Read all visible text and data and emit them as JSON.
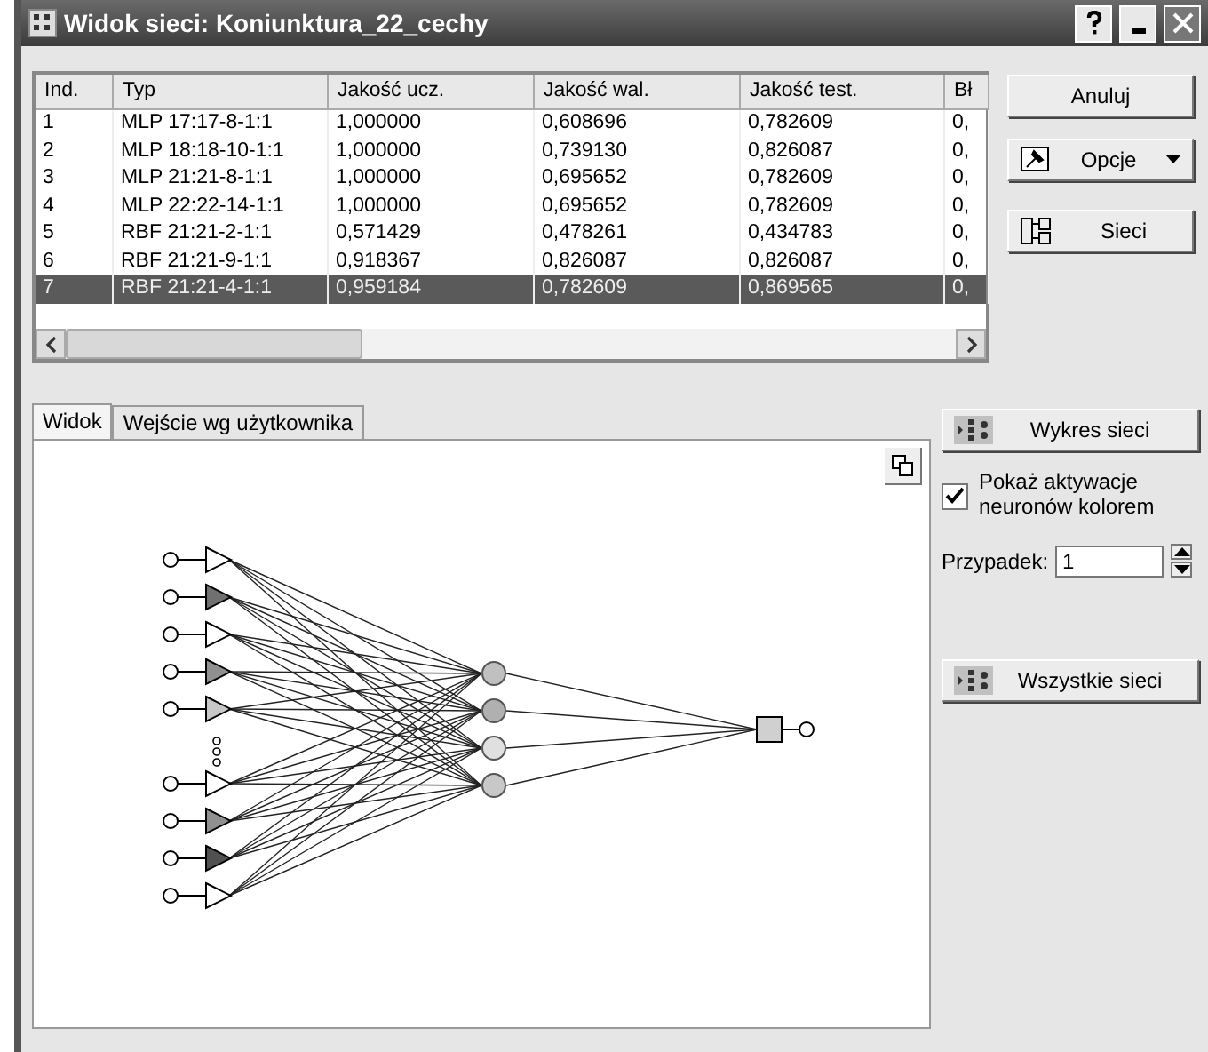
{
  "window": {
    "title": "Widok sieci: Koniunktura_22_cechy"
  },
  "table": {
    "columns": [
      "Ind.",
      "Typ",
      "Jakość ucz.",
      "Jakość wal.",
      "Jakość test.",
      "Bł"
    ],
    "rows": [
      {
        "cells": [
          "1",
          "MLP 17:17-8-1:1",
          "1,000000",
          "0,608696",
          "0,782609",
          "0,"
        ],
        "selected": false
      },
      {
        "cells": [
          "2",
          "MLP 18:18-10-1:1",
          "1,000000",
          "0,739130",
          "0,826087",
          "0,"
        ],
        "selected": false
      },
      {
        "cells": [
          "3",
          "MLP 21:21-8-1:1",
          "1,000000",
          "0,695652",
          "0,782609",
          "0,"
        ],
        "selected": false
      },
      {
        "cells": [
          "4",
          "MLP 22:22-14-1:1",
          "1,000000",
          "0,695652",
          "0,782609",
          "0,"
        ],
        "selected": false
      },
      {
        "cells": [
          "5",
          "RBF 21:21-2-1:1",
          "0,571429",
          "0,478261",
          "0,434783",
          "0,"
        ],
        "selected": false
      },
      {
        "cells": [
          "6",
          "RBF 21:21-9-1:1",
          "0,918367",
          "0,826087",
          "0,826087",
          "0,"
        ],
        "selected": false
      },
      {
        "cells": [
          "7",
          "RBF 21:21-4-1:1",
          "0,959184",
          "0,782609",
          "0,869565",
          "0,"
        ],
        "selected": true
      }
    ]
  },
  "side_buttons": [
    {
      "label": "Anuluj",
      "kind": "plain"
    },
    {
      "label": "Opcje",
      "kind": "menu"
    },
    {
      "label": "Sieci",
      "kind": "networks"
    }
  ],
  "tabs": [
    {
      "label": "Widok",
      "selected": true
    },
    {
      "label": "Wejście wg użytkownika",
      "selected": false
    }
  ],
  "network": {
    "inputs": [
      {
        "color": "#ffffff"
      },
      {
        "color": "#707070"
      },
      {
        "color": "#ffffff"
      },
      {
        "color": "#909090"
      },
      {
        "color": "#c8c8c8"
      },
      {
        "color": "#ffffff"
      },
      {
        "color": "#909090"
      },
      {
        "color": "#505050"
      },
      {
        "color": "#ffffff"
      }
    ],
    "hidden": [
      {
        "color": "#c0c0c0"
      },
      {
        "color": "#b0b0b0"
      },
      {
        "color": "#e0e0e0"
      },
      {
        "color": "#c8c8c8"
      }
    ],
    "output": {
      "color": "#d0d0d0"
    }
  },
  "chart_button": {
    "label": "Wykres sieci"
  },
  "show_activation": {
    "label": "Pokaż aktywacje neuronów kolorem",
    "checked": true
  },
  "case": {
    "label": "Przypadek:",
    "value": "1"
  },
  "all_networks_button": {
    "label": "Wszystkie sieci"
  }
}
